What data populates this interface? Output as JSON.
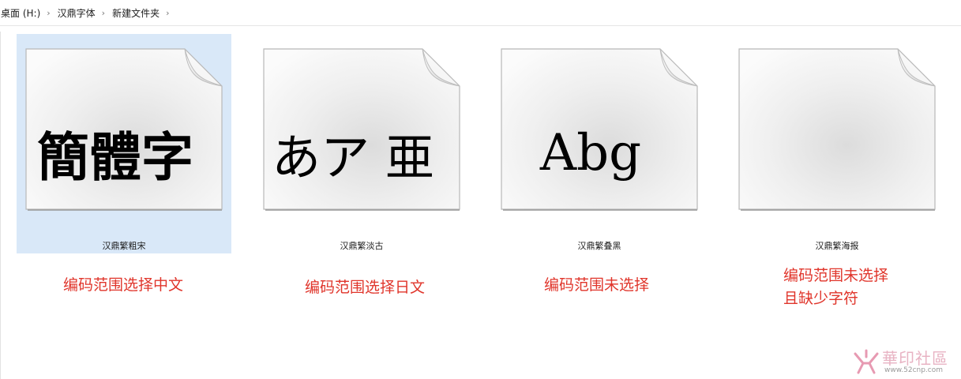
{
  "breadcrumb": [
    "桌面 (H:)",
    "汉鼎字体",
    "新建文件夹"
  ],
  "files": [
    {
      "name": "汉鼎繁粗宋",
      "glyphs": "簡體字",
      "selected": true
    },
    {
      "name": "汉鼎繁淡古",
      "glyphs": "あア 亜",
      "selected": false
    },
    {
      "name": "汉鼎繁叠黑",
      "glyphs": "Abg",
      "selected": false
    },
    {
      "name": "汉鼎繁海报",
      "glyphs": "",
      "selected": false
    }
  ],
  "annotations": [
    {
      "line1": "编码范围选择中文",
      "line2": ""
    },
    {
      "line1": "编码范围选择日文",
      "line2": ""
    },
    {
      "line1": "编码范围未选择",
      "line2": ""
    },
    {
      "line1": "编码范围未选择",
      "line2": "且缺少字符"
    }
  ],
  "watermark": {
    "text": "華印社區",
    "url": "www.52cnp.com"
  },
  "colors": {
    "annotation": "#e0352b",
    "selection": "#d9e8f8"
  }
}
